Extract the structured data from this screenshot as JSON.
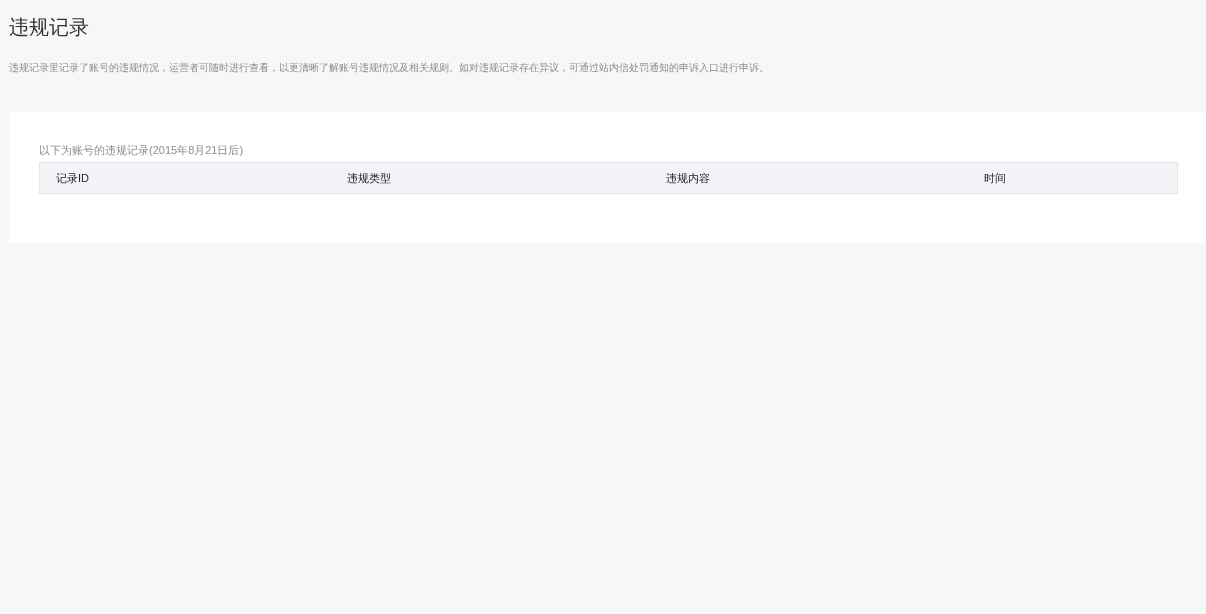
{
  "page": {
    "title": "违规记录",
    "description": "违规记录里记录了账号的违规情况，运营者可随时进行查看，以更清晰了解账号违规情况及相关规则。如对违规记录存在异议，可通过站内信处罚通知的申诉入口进行申诉。"
  },
  "records": {
    "caption": "以下为账号的违规记录(2015年8月21日后)",
    "table": {
      "columns": [
        "记录ID",
        "违规类型",
        "违规内容",
        "时间"
      ]
    }
  }
}
